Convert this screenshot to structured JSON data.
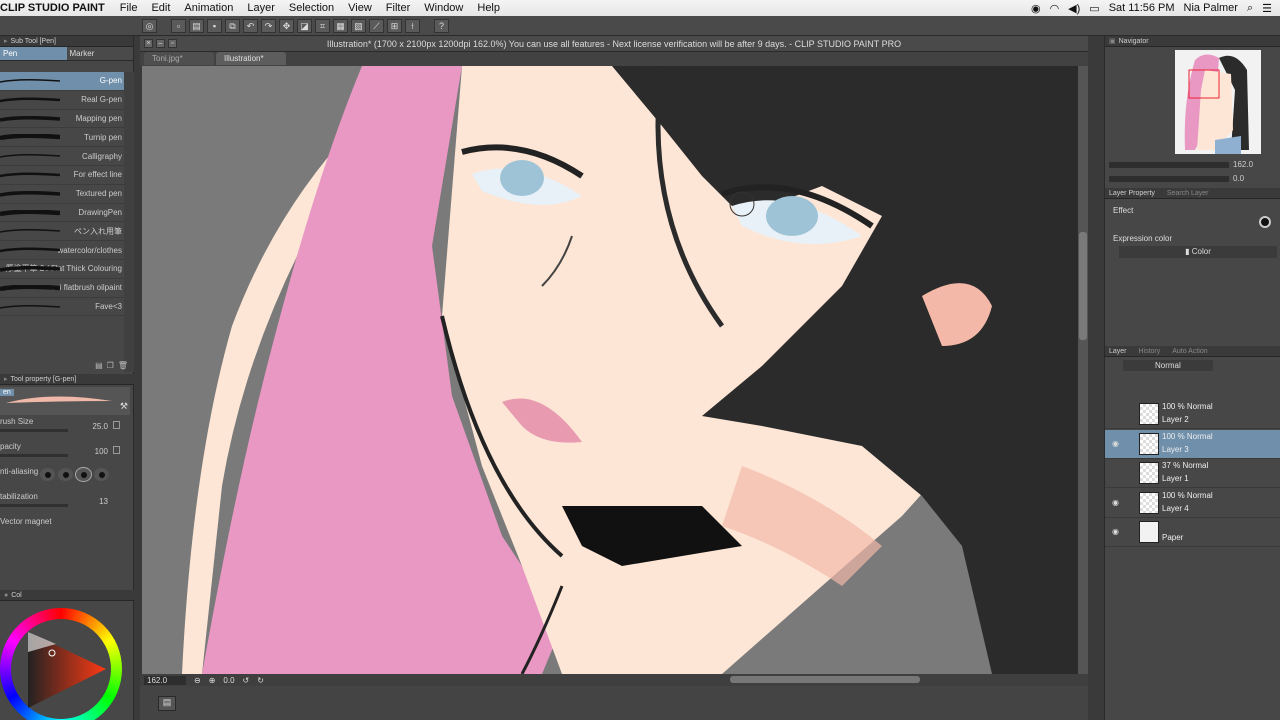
{
  "menubar": {
    "app_name": "CLIP STUDIO PAINT",
    "menus": [
      "File",
      "Edit",
      "Animation",
      "Layer",
      "Selection",
      "View",
      "Filter",
      "Window",
      "Help"
    ],
    "clock": "Sat 11:56 PM",
    "user": "Nia Palmer"
  },
  "document": {
    "title": "Illustration* (1700 x 2100px 1200dpi 162.0%)  You can use all features - Next license verification will be after 9 days. - CLIP STUDIO PAINT PRO",
    "tabs": [
      {
        "label": "Toni.jpg*",
        "active": false
      },
      {
        "label": "Illustration*",
        "active": true
      }
    ],
    "zoom": "162.0",
    "rotation": "0.0"
  },
  "subtool": {
    "panel_title": "Sub Tool [Pen]",
    "tabs": [
      "Pen",
      "Marker"
    ],
    "brushes": [
      {
        "label": "G-pen",
        "selected": true
      },
      {
        "label": "Real G-pen",
        "selected": false
      },
      {
        "label": "Mapping pen",
        "selected": false
      },
      {
        "label": "Turnip pen",
        "selected": false
      },
      {
        "label": "Calligraphy",
        "selected": false
      },
      {
        "label": "For effect line",
        "selected": false
      },
      {
        "label": "Textured pen",
        "selected": false
      },
      {
        "label": "DrawingPen",
        "selected": false
      },
      {
        "label": "ペン入れ用筆",
        "selected": false
      },
      {
        "label": "watercolor/clothes",
        "selected": false
      },
      {
        "label": "厚塗平筆 2 / Flat Thick Colouring",
        "selected": false
      },
      {
        "label": "sai flatbrush oilpaint",
        "selected": false
      },
      {
        "label": "Fave<3",
        "selected": false
      }
    ]
  },
  "toolprop": {
    "panel_title": "Tool property [G-pen]",
    "preview_label": "en",
    "rows": [
      {
        "name": "rush Size",
        "value": "25.0"
      },
      {
        "name": "pacity",
        "value": "100"
      },
      {
        "name": "nti-aliasing",
        "value": ""
      },
      {
        "name": "tabilization",
        "value": "13"
      },
      {
        "name": "Vector magnet",
        "value": ""
      }
    ]
  },
  "color": {
    "panel_title": "Col",
    "h": "16",
    "s": "80",
    "v": "81"
  },
  "navigator": {
    "panel_title": "Navigator",
    "zoom_value": "162.0",
    "rotate_value": "0.0"
  },
  "layer_property": {
    "tabs": [
      "Layer Property",
      "Search Layer"
    ],
    "effect_label": "Effect",
    "expression_label": "Expression color",
    "expression_value": "Color"
  },
  "layers": {
    "tabs": [
      "Layer",
      "History",
      "Auto Action"
    ],
    "blend_mode": "Normal",
    "items": [
      {
        "mode": "100 % Normal",
        "name": "Layer 2",
        "visible": false,
        "selected": false
      },
      {
        "mode": "100 % Normal",
        "name": "Layer 3",
        "visible": true,
        "selected": true
      },
      {
        "mode": "37 % Normal",
        "name": "Layer 1",
        "visible": false,
        "selected": false
      },
      {
        "mode": "100 % Normal",
        "name": "Layer 4",
        "visible": true,
        "selected": false
      },
      {
        "mode": "",
        "name": "Paper",
        "visible": true,
        "selected": false
      }
    ]
  },
  "colors": {
    "accent": "#6f8faa",
    "skin": "#fde6d6",
    "hair_pink": "#e898c3",
    "hair_black": "#2b2b2b",
    "eye": "#9ec3d6"
  }
}
